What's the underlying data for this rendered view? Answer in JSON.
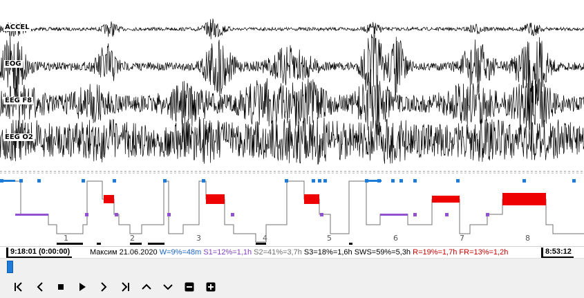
{
  "channels": [
    {
      "id": "accel",
      "label": "ACCEL"
    },
    {
      "id": "eog",
      "label": "EOG"
    },
    {
      "id": "eegf8",
      "label": "EEG F8"
    },
    {
      "id": "eego2",
      "label": "EEG O2"
    }
  ],
  "hypnogram": {
    "cycle_labels": [
      "1",
      "2",
      "3",
      "4",
      "5",
      "6",
      "7",
      "8"
    ],
    "colors": {
      "wake": "#1e7bd8",
      "rem": "#ee0000",
      "s1": "#9050d0",
      "deep": "#000000",
      "line": "#707070"
    }
  },
  "status": {
    "start_time": "9:18:01 (0:00:00)",
    "end_time": "8:53:12",
    "stats": [
      {
        "text": "Максим 21.06.2020",
        "color": "#000000"
      },
      {
        "text": "W=9%=48m",
        "color": "#1e64c8"
      },
      {
        "text": "S1=12%=1,1h",
        "color": "#8040c0"
      },
      {
        "text": "S2=41%=3,7h",
        "color": "#707070"
      },
      {
        "text": "S3=18%=1,6h",
        "color": "#000000"
      },
      {
        "text": "SWS=59%=5,3h",
        "color": "#000000"
      },
      {
        "text": "R=19%=1,7h",
        "color": "#cc0000"
      },
      {
        "text": "FR=13%=1,2h",
        "color": "#cc0000"
      }
    ]
  },
  "scrollbar": {
    "position": 0.0
  },
  "toolbar": {
    "buttons": [
      {
        "name": "first-button",
        "icon": "skip-first-icon"
      },
      {
        "name": "prev-button",
        "icon": "chevron-left-icon"
      },
      {
        "name": "stop-button",
        "icon": "stop-icon"
      },
      {
        "name": "play-button",
        "icon": "play-icon"
      },
      {
        "name": "next-button",
        "icon": "chevron-right-icon"
      },
      {
        "name": "last-button",
        "icon": "skip-last-icon"
      },
      {
        "name": "scale-up-button",
        "icon": "chevron-up-icon"
      },
      {
        "name": "scale-down-button",
        "icon": "chevron-down-icon"
      },
      {
        "name": "zoom-out-button",
        "icon": "minus-icon"
      },
      {
        "name": "zoom-in-button",
        "icon": "plus-icon"
      }
    ]
  }
}
